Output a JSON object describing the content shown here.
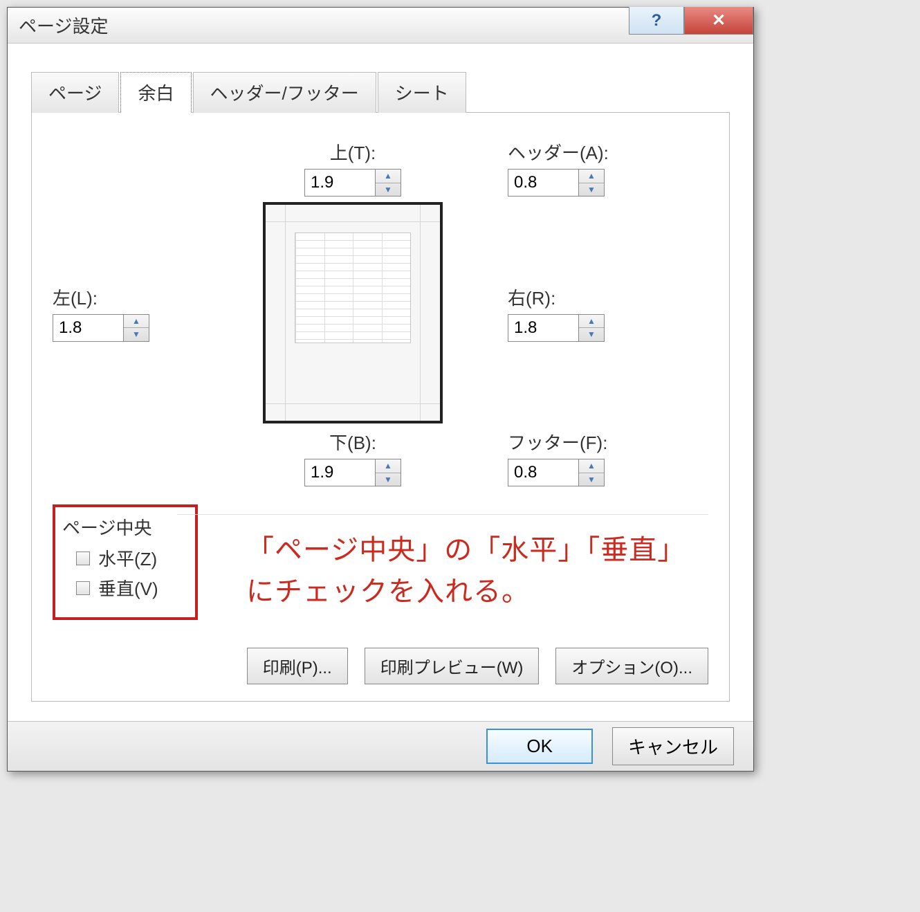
{
  "dialog": {
    "title": "ページ設定",
    "help_glyph": "?",
    "close_glyph": "✕"
  },
  "tabs": {
    "page": "ページ",
    "margins": "余白",
    "headerfooter": "ヘッダー/フッター",
    "sheet": "シート"
  },
  "margins": {
    "top_label": "上(T):",
    "top_value": "1.9",
    "header_label": "ヘッダー(A):",
    "header_value": "0.8",
    "left_label": "左(L):",
    "left_value": "1.8",
    "right_label": "右(R):",
    "right_value": "1.8",
    "bottom_label": "下(B):",
    "bottom_value": "1.9",
    "footer_label": "フッター(F):",
    "footer_value": "0.8"
  },
  "center": {
    "legend": "ページ中央",
    "horizontal": "水平(Z)",
    "vertical": "垂直(V)"
  },
  "annotation": "「ページ中央」の「水平」「垂直」\nにチェックを入れる。",
  "buttons": {
    "print": "印刷(P)...",
    "preview": "印刷プレビュー(W)",
    "options": "オプション(O)..."
  },
  "footer": {
    "ok": "OK",
    "cancel": "キャンセル"
  }
}
